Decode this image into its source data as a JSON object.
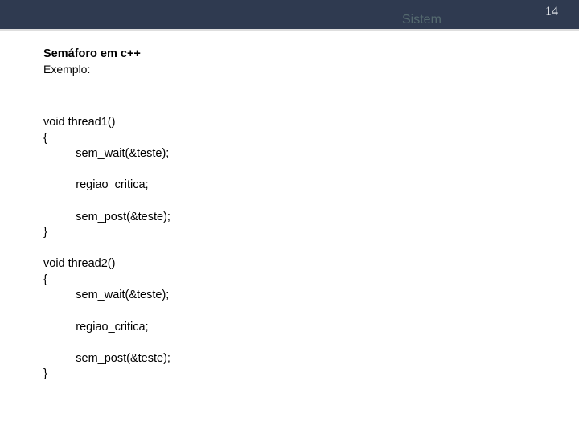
{
  "header": {
    "label": "Sistem",
    "page_number": "14"
  },
  "content": {
    "title": "Semáforo em c++",
    "subtitle": "Exemplo:",
    "code_line_1": "void thread1()",
    "code_line_2": "{",
    "code_line_3": "          sem_wait(&teste);",
    "code_line_4": "",
    "code_line_5": "          regiao_critica;",
    "code_line_6": "",
    "code_line_7": "          sem_post(&teste);",
    "code_line_8": "}",
    "code_line_9": "",
    "code_line_10": "void thread2()",
    "code_line_11": "{",
    "code_line_12": "          sem_wait(&teste);",
    "code_line_13": "",
    "code_line_14": "          regiao_critica;",
    "code_line_15": "",
    "code_line_16": "          sem_post(&teste);",
    "code_line_17": "}"
  }
}
